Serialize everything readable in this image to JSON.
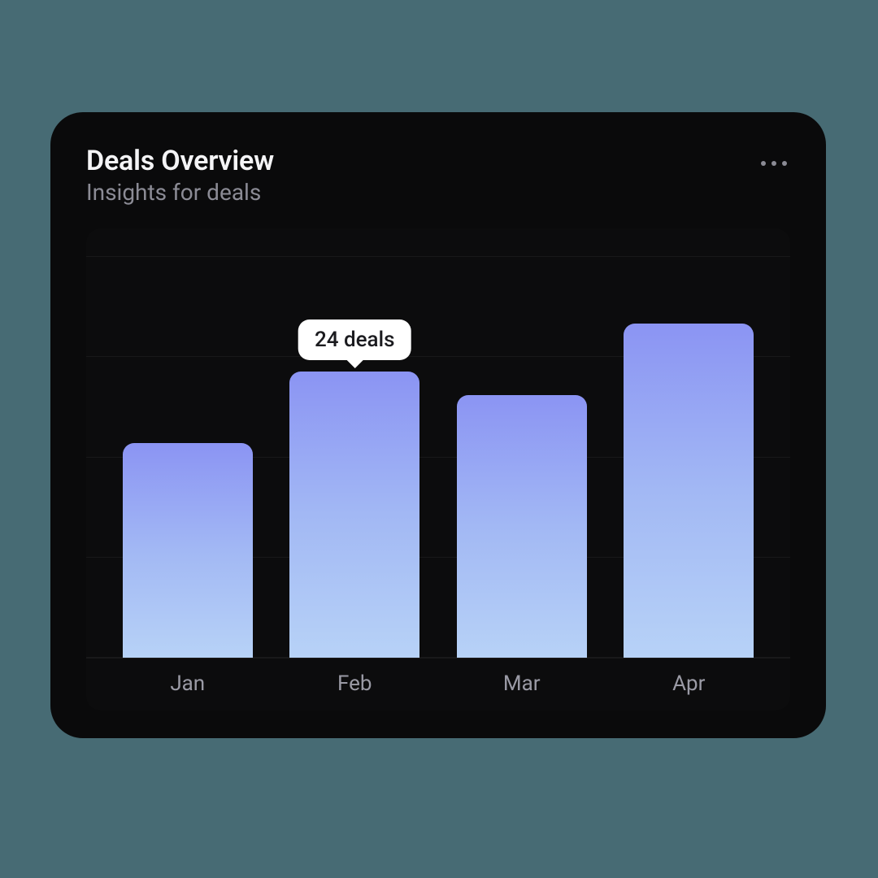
{
  "header": {
    "title": "Deals Overview",
    "subtitle": "Insights for deals"
  },
  "tooltip": {
    "text": "24 deals",
    "targetIndex": 1
  },
  "chart_data": {
    "type": "bar",
    "title": "Deals Overview",
    "xlabel": "",
    "ylabel": "",
    "categories": [
      "Jan",
      "Feb",
      "Mar",
      "Apr"
    ],
    "values": [
      18,
      24,
      22,
      28
    ],
    "ylim": [
      0,
      36
    ],
    "gridlines": 5,
    "bar_gradient": [
      "#8b94f3",
      "#b7d2f7"
    ]
  }
}
